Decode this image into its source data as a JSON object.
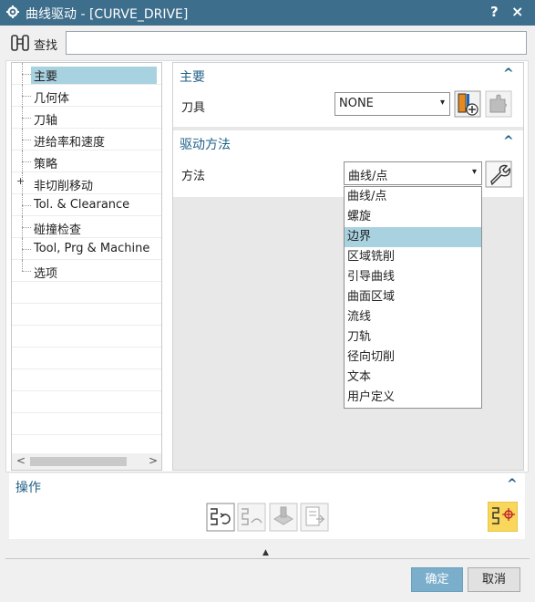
{
  "window": {
    "title": "曲线驱动 - [CURVE_DRIVE]",
    "help_label": "?",
    "close_label": "×"
  },
  "find": {
    "label": "查找",
    "value": ""
  },
  "tree": {
    "items": [
      {
        "label": "主要",
        "selected": true,
        "expandable": false
      },
      {
        "label": "几何体",
        "selected": false,
        "expandable": false
      },
      {
        "label": "刀轴",
        "selected": false,
        "expandable": false
      },
      {
        "label": "进给率和速度",
        "selected": false,
        "expandable": false
      },
      {
        "label": "策略",
        "selected": false,
        "expandable": false
      },
      {
        "label": "非切削移动",
        "selected": false,
        "expandable": true
      },
      {
        "label": "Tol. & Clearance",
        "selected": false,
        "expandable": false
      },
      {
        "label": "碰撞检查",
        "selected": false,
        "expandable": false
      },
      {
        "label": "Tool, Prg & Machine",
        "selected": false,
        "expandable": false
      },
      {
        "label": "选项",
        "selected": false,
        "expandable": false
      }
    ],
    "expand_symbol": "+",
    "scroll_left": "<",
    "scroll_right": ">"
  },
  "main_group": {
    "title": "主要",
    "collapse_symbol": "^",
    "tool_label": "刀具",
    "tool_value": "NONE",
    "dropdown_arrow": "▾"
  },
  "drive_group": {
    "title": "驱动方法",
    "collapse_symbol": "^",
    "method_label": "方法",
    "method_value": "曲线/点",
    "dropdown_arrow": "▾",
    "options": [
      "曲线/点",
      "螺旋",
      "边界",
      "区域铣削",
      "引导曲线",
      "曲面区域",
      "流线",
      "刀轨",
      "径向切削",
      "文本",
      "用户定义"
    ],
    "highlighted_option": "边界"
  },
  "operations": {
    "title": "操作",
    "collapse_symbol": "^"
  },
  "footer": {
    "expand_arrow": "▲",
    "ok_label": "确定",
    "cancel_label": "取消"
  },
  "colors": {
    "titlebar": "#3d6e8c",
    "selection": "#a9d2e0",
    "group_title": "#1f5f87",
    "ok_button": "#7aaecb"
  }
}
